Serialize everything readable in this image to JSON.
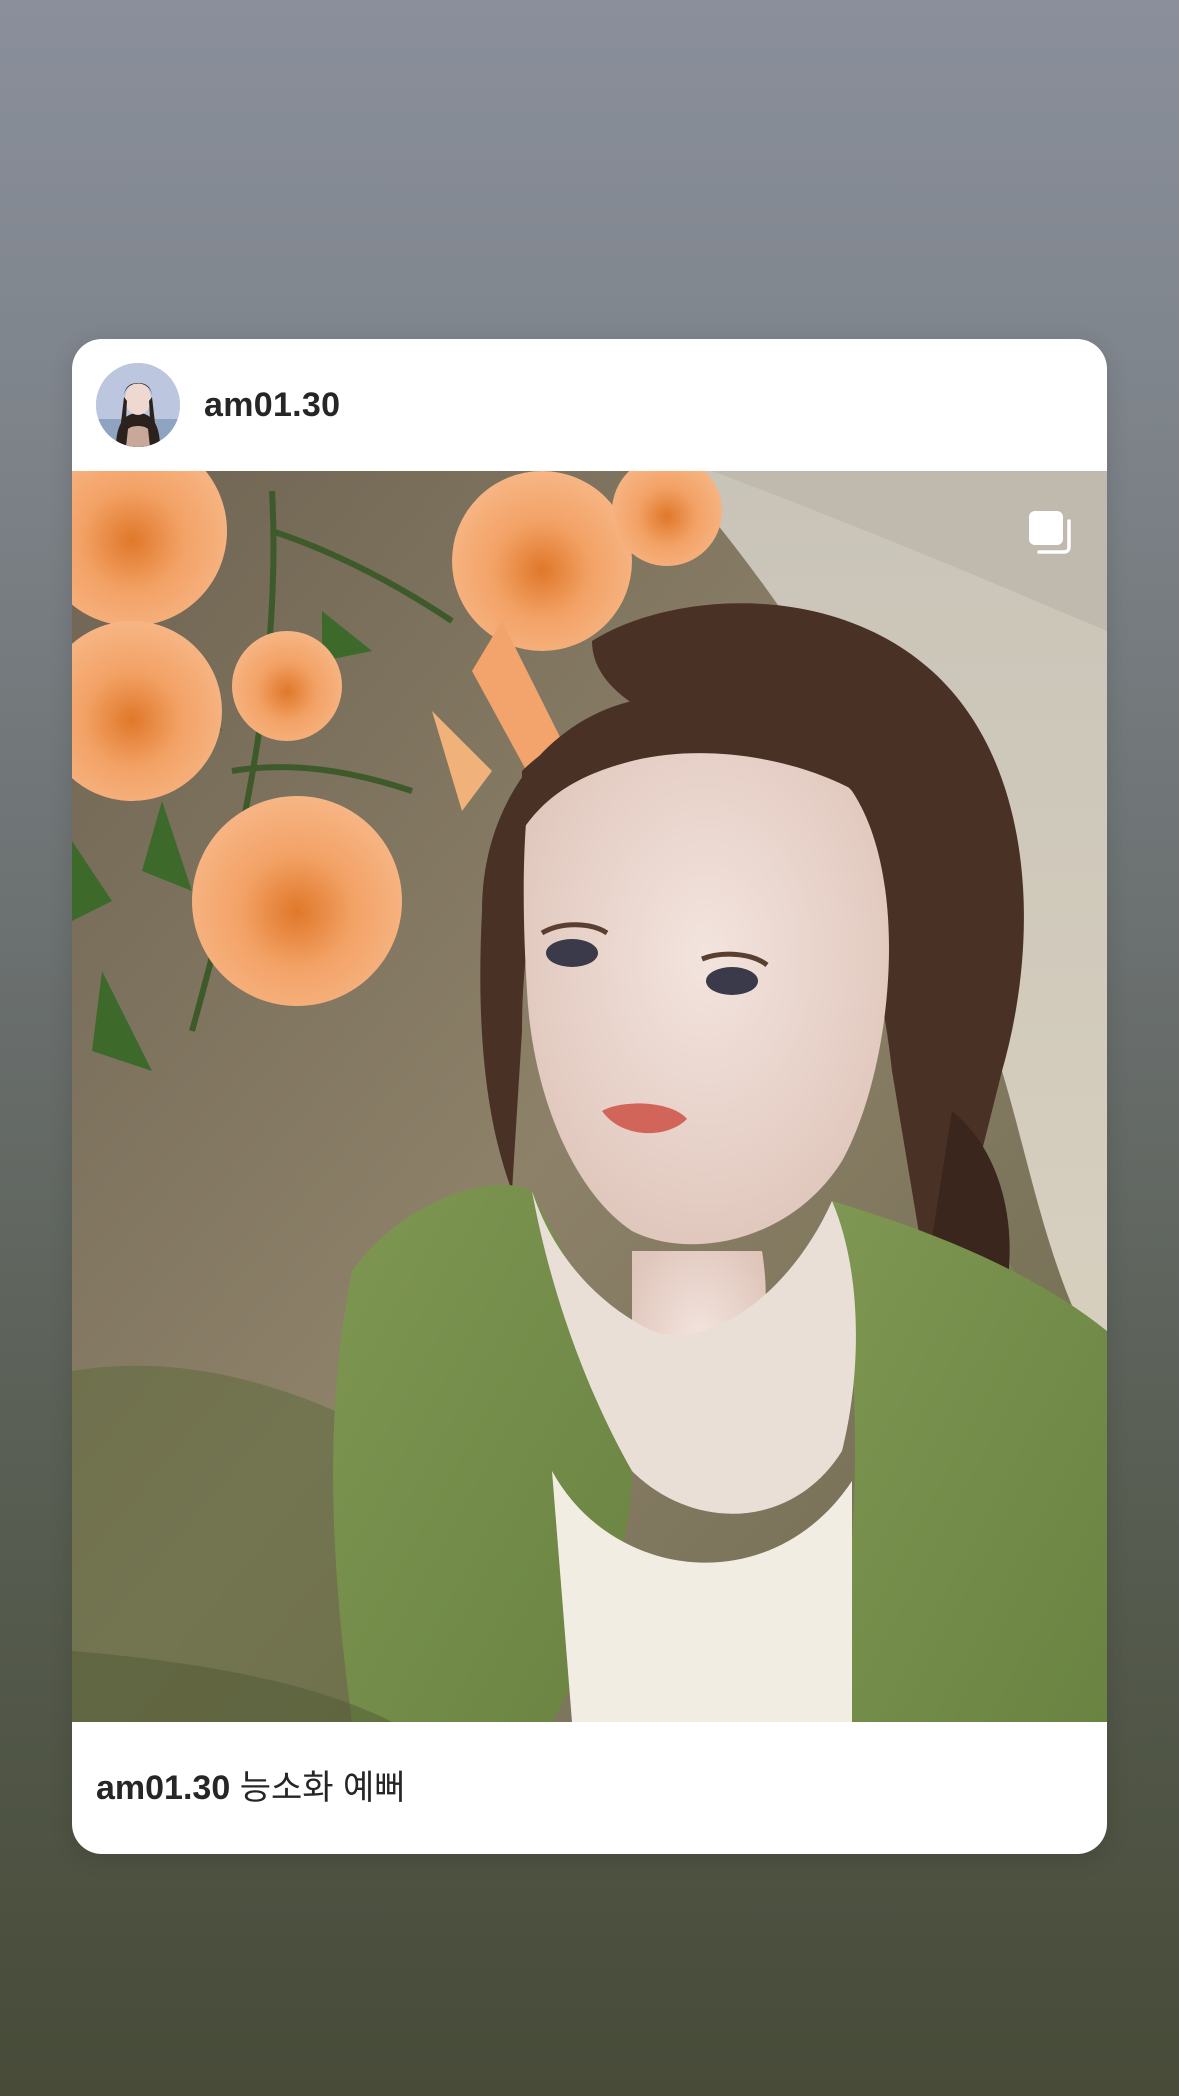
{
  "story": {
    "background_top": "#8a8f9b",
    "background_bottom": "#474b38"
  },
  "post": {
    "username": "am01.30",
    "avatar_icon": "profile-avatar",
    "carousel_icon": "multiple-images-icon",
    "caption": {
      "username": "am01.30",
      "text": "능소화 예뻐"
    }
  }
}
